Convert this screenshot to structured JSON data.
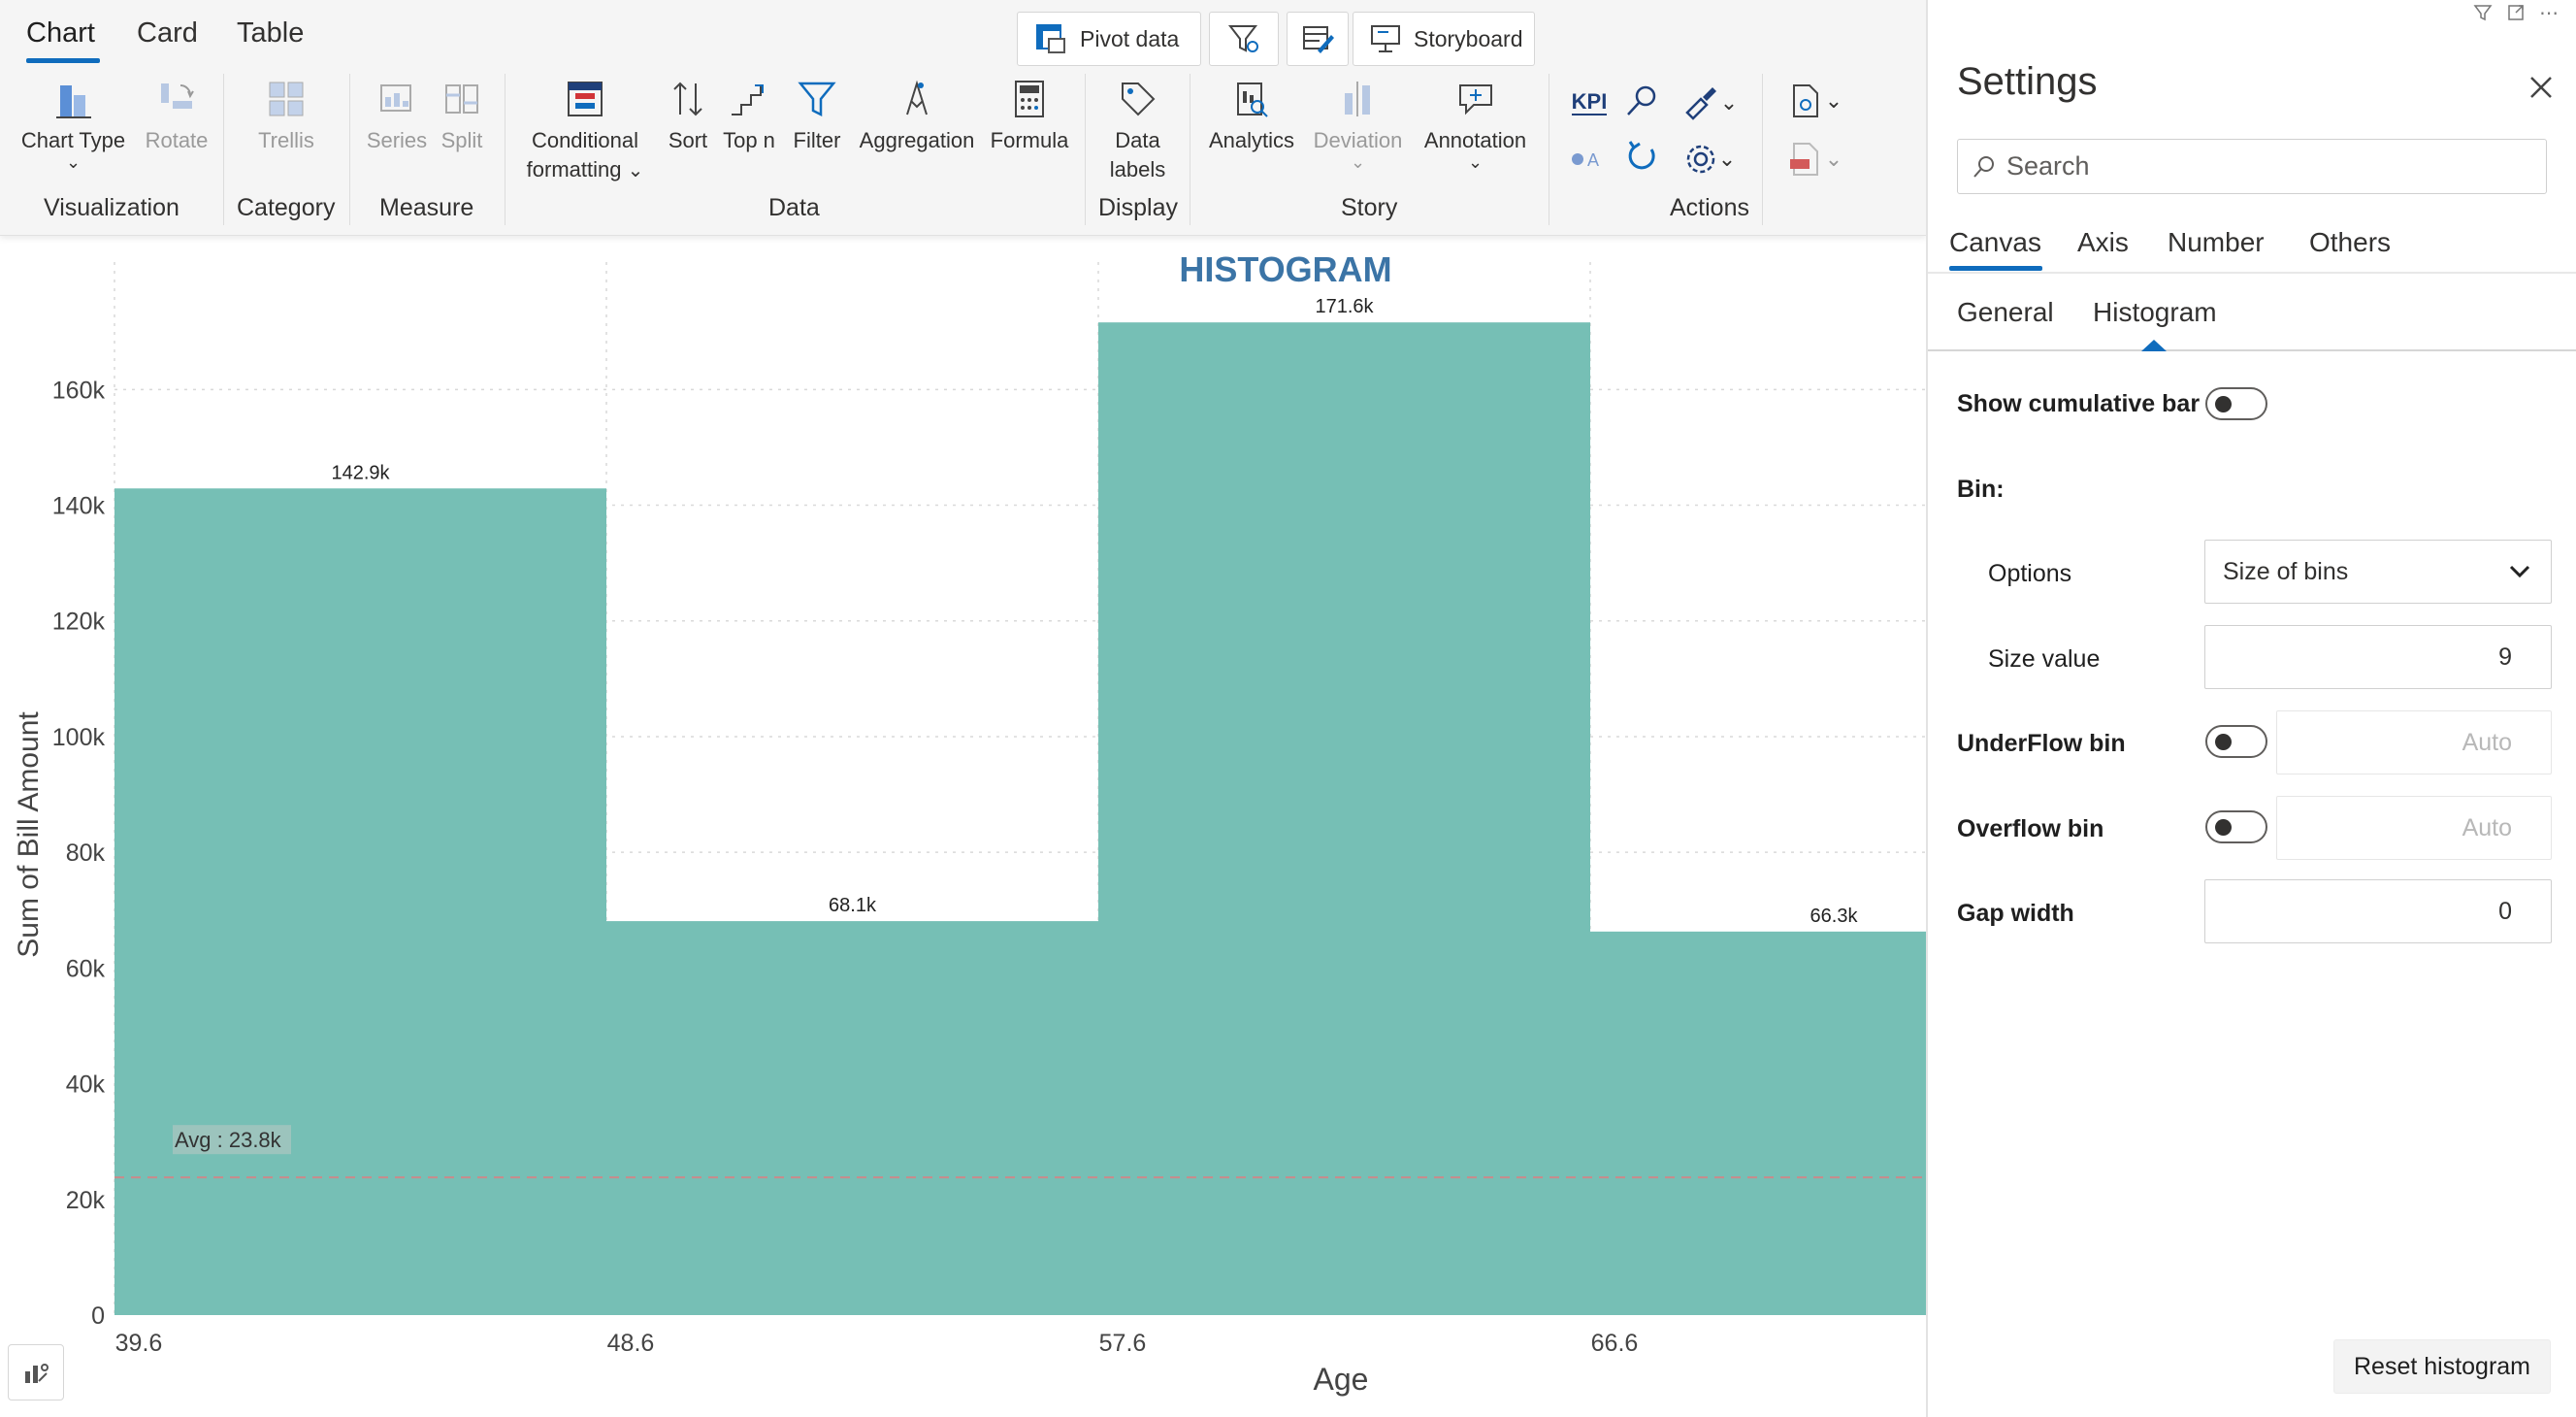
{
  "ribbon": {
    "tabs": [
      "Chart",
      "Card",
      "Table"
    ],
    "top_buttons": {
      "pivot": "Pivot  data",
      "storyboard": "Storyboard"
    },
    "visualization": {
      "chart_type": "Chart Type",
      "rotate": "Rotate",
      "label": "Visualization"
    },
    "category": {
      "trellis": "Trellis",
      "label": "Category"
    },
    "measure": {
      "series": "Series",
      "split": "Split",
      "label": "Measure"
    },
    "data": {
      "conditional_1": "Conditional",
      "conditional_2": "formatting",
      "sort": "Sort",
      "topn": "Top n",
      "filter": "Filter",
      "aggregation": "Aggregation",
      "formula": "Formula",
      "label": "Data"
    },
    "display": {
      "data_labels_1": "Data",
      "data_labels_2": "labels",
      "label": "Display"
    },
    "story": {
      "analytics": "Analytics",
      "deviation": "Deviation",
      "annotation": "Annotation",
      "label": "Story"
    },
    "actions": {
      "kpi": "KPI",
      "label": "Actions"
    }
  },
  "chart_data": {
    "type": "bar",
    "title": "HISTOGRAM",
    "xlabel": "Age",
    "ylabel": "Sum of Bill Amount",
    "bin_edges": [
      39.6,
      48.6,
      57.6,
      66.6
    ],
    "x_tick_labels": [
      "39.6",
      "48.6",
      "57.6",
      "66.6"
    ],
    "values": [
      142900,
      68100,
      171600,
      66300
    ],
    "value_labels": [
      "142.9k",
      "68.1k",
      "171.6k",
      "66.3k"
    ],
    "ylim": [
      0,
      177000
    ],
    "y_ticks": [
      0,
      20000,
      40000,
      60000,
      80000,
      100000,
      120000,
      140000,
      160000
    ],
    "y_tick_labels": [
      "0",
      "20k",
      "40k",
      "60k",
      "80k",
      "100k",
      "120k",
      "140k",
      "160k"
    ],
    "average": 23800,
    "average_label": "Avg : 23.8k",
    "bar_color": "#76bfb5",
    "grid": true
  },
  "settings": {
    "title": "Settings",
    "search_placeholder": "Search",
    "tabs": [
      "Canvas",
      "Axis",
      "Number",
      "Others"
    ],
    "subtabs": [
      "General",
      "Histogram"
    ],
    "show_cumulative_bar": "Show cumulative bar",
    "bin": "Bin:",
    "options_label": "Options",
    "options_value": "Size of bins",
    "size_value_label": "Size value",
    "size_value": "9",
    "underflow_label": "UnderFlow bin",
    "underflow_value": "Auto",
    "overflow_label": "Overflow bin",
    "overflow_value": "Auto",
    "gap_width_label": "Gap width",
    "gap_width_value": "0",
    "reset_button": "Reset histogram"
  }
}
